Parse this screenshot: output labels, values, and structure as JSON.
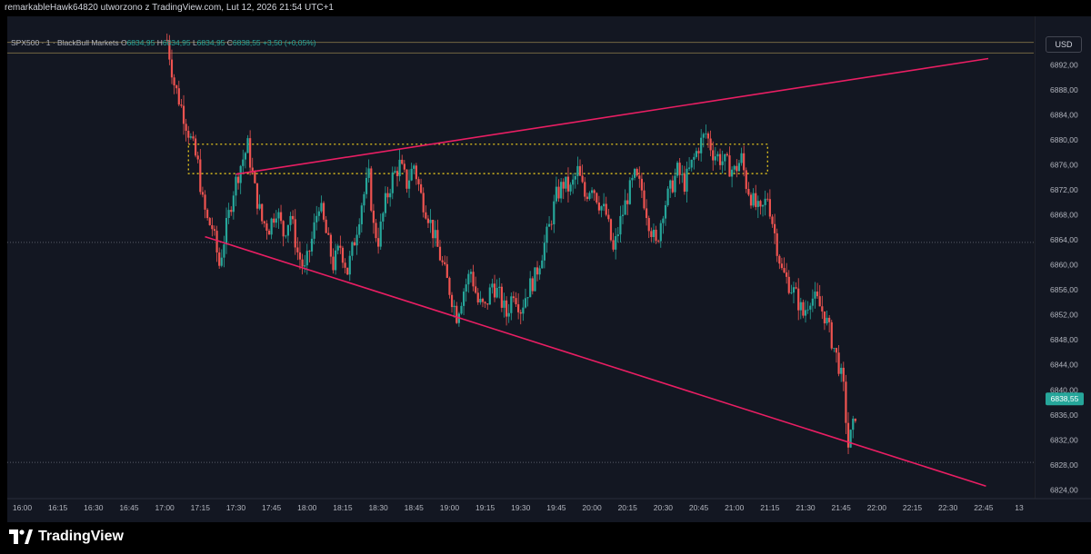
{
  "header": {
    "text": "remarkableHawk64820 utworzono z TradingView.com, Lut 12, 2026 21:54 UTC+1"
  },
  "legend": {
    "symbol": "SPX500 · 1 · BlackBull Markets",
    "o_label": "O",
    "o_value": "6834,95",
    "h_label": "H",
    "h_value": "6834,95",
    "l_label": "L",
    "l_value": "6834,95",
    "c_label": "C",
    "c_value": "6838,55",
    "change": "+3,50 (+0,05%)"
  },
  "currency": "USD",
  "footer": {
    "brand": "TradingView"
  },
  "colors": {
    "background": "#131722",
    "up": "#26a69a",
    "down": "#ef5350",
    "trendline": "#e91e63",
    "zone": "#f9d71c",
    "price_badge": "#26a69a"
  },
  "chart_data": {
    "type": "candlestick",
    "symbol": "SPX500",
    "interval": "1",
    "y_ticks": [
      "6892,00",
      "6888,00",
      "6884,00",
      "6880,00",
      "6876,00",
      "6872,00",
      "6868,00",
      "6864,00",
      "6860,00",
      "6856,00",
      "6852,00",
      "6848,00",
      "6844,00",
      "6840,00",
      "6836,00",
      "6832,00",
      "6828,00",
      "6824,00"
    ],
    "y_tick_values": [
      6892,
      6888,
      6884,
      6880,
      6876,
      6872,
      6868,
      6864,
      6860,
      6856,
      6852,
      6848,
      6844,
      6840,
      6836,
      6832,
      6828,
      6824
    ],
    "x_ticks": [
      "16:00",
      "16:15",
      "16:30",
      "16:45",
      "17:00",
      "17:15",
      "17:30",
      "17:45",
      "18:00",
      "18:15",
      "18:30",
      "18:45",
      "19:00",
      "19:15",
      "19:30",
      "19:45",
      "20:00",
      "20:15",
      "20:30",
      "20:45",
      "21:00",
      "21:15",
      "21:30",
      "21:45",
      "22:00",
      "22:15",
      "22:30",
      "22:45",
      "13"
    ],
    "x_tick_minutes": [
      960,
      975,
      990,
      1005,
      1020,
      1035,
      1050,
      1065,
      1080,
      1095,
      1110,
      1125,
      1140,
      1155,
      1170,
      1185,
      1200,
      1215,
      1230,
      1245,
      1260,
      1275,
      1290,
      1305,
      1320,
      1335,
      1350,
      1365,
      1380
    ],
    "ylim": [
      6822.6,
      6896.2
    ],
    "last_price": "6838,55",
    "last_price_value": 6838.55,
    "close_path": [
      {
        "t": 1021,
        "v": 6896
      },
      {
        "t": 1024,
        "v": 6889
      },
      {
        "t": 1028,
        "v": 6884
      },
      {
        "t": 1031,
        "v": 6880
      },
      {
        "t": 1034,
        "v": 6876
      },
      {
        "t": 1036,
        "v": 6870
      },
      {
        "t": 1038,
        "v": 6867
      },
      {
        "t": 1040,
        "v": 6866
      },
      {
        "t": 1043,
        "v": 6860
      },
      {
        "t": 1046,
        "v": 6866
      },
      {
        "t": 1049,
        "v": 6872
      },
      {
        "t": 1052,
        "v": 6876
      },
      {
        "t": 1055,
        "v": 6879
      },
      {
        "t": 1058,
        "v": 6872
      },
      {
        "t": 1061,
        "v": 6867
      },
      {
        "t": 1064,
        "v": 6866
      },
      {
        "t": 1067,
        "v": 6869
      },
      {
        "t": 1070,
        "v": 6865
      },
      {
        "t": 1073,
        "v": 6868
      },
      {
        "t": 1076,
        "v": 6862
      },
      {
        "t": 1079,
        "v": 6859
      },
      {
        "t": 1082,
        "v": 6864
      },
      {
        "t": 1085,
        "v": 6870
      },
      {
        "t": 1088,
        "v": 6865
      },
      {
        "t": 1091,
        "v": 6860
      },
      {
        "t": 1094,
        "v": 6863
      },
      {
        "t": 1097,
        "v": 6859
      },
      {
        "t": 1100,
        "v": 6864
      },
      {
        "t": 1103,
        "v": 6870
      },
      {
        "t": 1106,
        "v": 6874
      },
      {
        "t": 1108,
        "v": 6866
      },
      {
        "t": 1110,
        "v": 6864
      },
      {
        "t": 1113,
        "v": 6870
      },
      {
        "t": 1116,
        "v": 6874
      },
      {
        "t": 1119,
        "v": 6876
      },
      {
        "t": 1122,
        "v": 6873
      },
      {
        "t": 1125,
        "v": 6876
      },
      {
        "t": 1128,
        "v": 6871
      },
      {
        "t": 1131,
        "v": 6868
      },
      {
        "t": 1134,
        "v": 6864
      },
      {
        "t": 1137,
        "v": 6860
      },
      {
        "t": 1140,
        "v": 6856
      },
      {
        "t": 1143,
        "v": 6852
      },
      {
        "t": 1146,
        "v": 6856
      },
      {
        "t": 1149,
        "v": 6859
      },
      {
        "t": 1152,
        "v": 6854
      },
      {
        "t": 1155,
        "v": 6853
      },
      {
        "t": 1158,
        "v": 6857
      },
      {
        "t": 1161,
        "v": 6855
      },
      {
        "t": 1164,
        "v": 6852
      },
      {
        "t": 1167,
        "v": 6856
      },
      {
        "t": 1170,
        "v": 6853
      },
      {
        "t": 1173,
        "v": 6856
      },
      {
        "t": 1176,
        "v": 6858
      },
      {
        "t": 1179,
        "v": 6862
      },
      {
        "t": 1182,
        "v": 6866
      },
      {
        "t": 1185,
        "v": 6871
      },
      {
        "t": 1188,
        "v": 6873
      },
      {
        "t": 1191,
        "v": 6872
      },
      {
        "t": 1194,
        "v": 6875
      },
      {
        "t": 1197,
        "v": 6871
      },
      {
        "t": 1200,
        "v": 6873
      },
      {
        "t": 1203,
        "v": 6870
      },
      {
        "t": 1206,
        "v": 6868
      },
      {
        "t": 1209,
        "v": 6862
      },
      {
        "t": 1212,
        "v": 6867
      },
      {
        "t": 1215,
        "v": 6871
      },
      {
        "t": 1218,
        "v": 6874
      },
      {
        "t": 1221,
        "v": 6872
      },
      {
        "t": 1224,
        "v": 6867
      },
      {
        "t": 1227,
        "v": 6863
      },
      {
        "t": 1230,
        "v": 6869
      },
      {
        "t": 1233,
        "v": 6872
      },
      {
        "t": 1236,
        "v": 6875
      },
      {
        "t": 1239,
        "v": 6873
      },
      {
        "t": 1242,
        "v": 6876
      },
      {
        "t": 1245,
        "v": 6879
      },
      {
        "t": 1248,
        "v": 6881
      },
      {
        "t": 1251,
        "v": 6878
      },
      {
        "t": 1254,
        "v": 6877
      },
      {
        "t": 1257,
        "v": 6876
      },
      {
        "t": 1260,
        "v": 6875
      },
      {
        "t": 1263,
        "v": 6877
      },
      {
        "t": 1265,
        "v": 6873
      },
      {
        "t": 1268,
        "v": 6870
      },
      {
        "t": 1271,
        "v": 6868
      },
      {
        "t": 1274,
        "v": 6871
      },
      {
        "t": 1277,
        "v": 6865
      },
      {
        "t": 1280,
        "v": 6859
      },
      {
        "t": 1283,
        "v": 6857
      },
      {
        "t": 1286,
        "v": 6855
      },
      {
        "t": 1289,
        "v": 6852
      },
      {
        "t": 1292,
        "v": 6855
      },
      {
        "t": 1295,
        "v": 6854
      },
      {
        "t": 1298,
        "v": 6852
      },
      {
        "t": 1301,
        "v": 6848
      },
      {
        "t": 1304,
        "v": 6844
      },
      {
        "t": 1306,
        "v": 6840
      },
      {
        "t": 1308,
        "v": 6831
      },
      {
        "t": 1310,
        "v": 6834
      },
      {
        "t": 1312,
        "v": 6838.55
      }
    ],
    "trendlines": [
      {
        "name": "upper-trendline",
        "t1": 1050,
        "v1": 6874.5,
        "t2": 1367,
        "v2": 6893
      },
      {
        "name": "lower-trendline",
        "t1": 1037,
        "v1": 6864.5,
        "t2": 1366,
        "v2": 6824.6
      }
    ],
    "zone": {
      "t1": 1030,
      "t2": 1274,
      "v_top": 6879.3,
      "v_bottom": 6874.6
    },
    "horizontal_lines": [
      {
        "name": "top-line-1",
        "v": 6895.6,
        "t1": 960,
        "t2": 1380
      },
      {
        "name": "top-line-2",
        "v": 6893.9,
        "t1": 960,
        "t2": 1380
      },
      {
        "name": "level-line-6864",
        "v": 6863.6,
        "t1": 960,
        "t2": 1380
      },
      {
        "name": "level-line-6828",
        "v": 6828.4,
        "t1": 960,
        "t2": 1380
      }
    ],
    "grid": false,
    "legend_position": "top-left"
  }
}
